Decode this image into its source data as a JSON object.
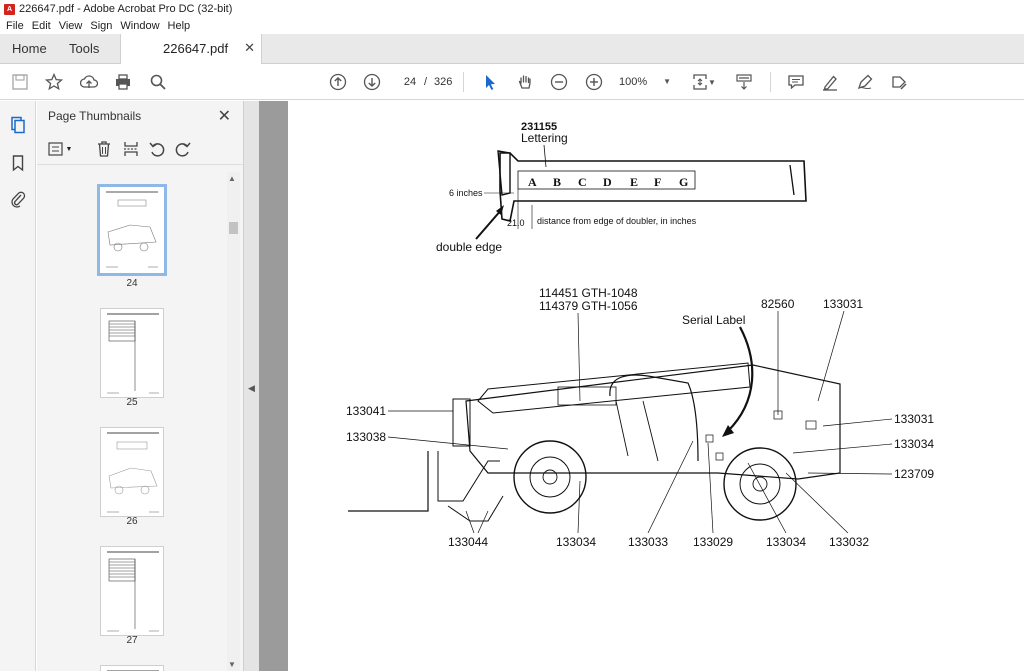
{
  "window": {
    "title": "226647.pdf - Adobe Acrobat Pro DC (32-bit)"
  },
  "menu": [
    "File",
    "Edit",
    "View",
    "Sign",
    "Window",
    "Help"
  ],
  "tabs": {
    "home": "Home",
    "tools": "Tools",
    "document": "226647.pdf"
  },
  "toolbar": {
    "current_page": "24",
    "separator": "/",
    "total_pages": "326",
    "zoom": "100%"
  },
  "thumbnails": {
    "header": "Page Thumbnails",
    "pages": [
      "24",
      "25",
      "26",
      "27"
    ]
  },
  "doc": {
    "top": {
      "part_no": "231155",
      "part_name": "Lettering",
      "letters": [
        "A",
        "B",
        "C",
        "D",
        "E",
        "F",
        "G"
      ],
      "inches_label": "6 inches",
      "distance_value": "21.0",
      "distance_caption": "distance from edge of doubler, in inches",
      "double_edge": "double edge"
    },
    "labels": {
      "model_1048": "114451 GTH-1048",
      "model_1056": "114379 GTH-1056",
      "serial_label": "Serial Label",
      "n82560": "82560",
      "n133031_top": "133031",
      "n133041": "133041",
      "n133038": "133038",
      "n133031_right": "133031",
      "n133034_right": "133034",
      "n123709": "123709",
      "n133044": "133044",
      "n133034_a": "133034",
      "n133033": "133033",
      "n133029": "133029",
      "n133034_b": "133034",
      "n133032": "133032"
    }
  }
}
